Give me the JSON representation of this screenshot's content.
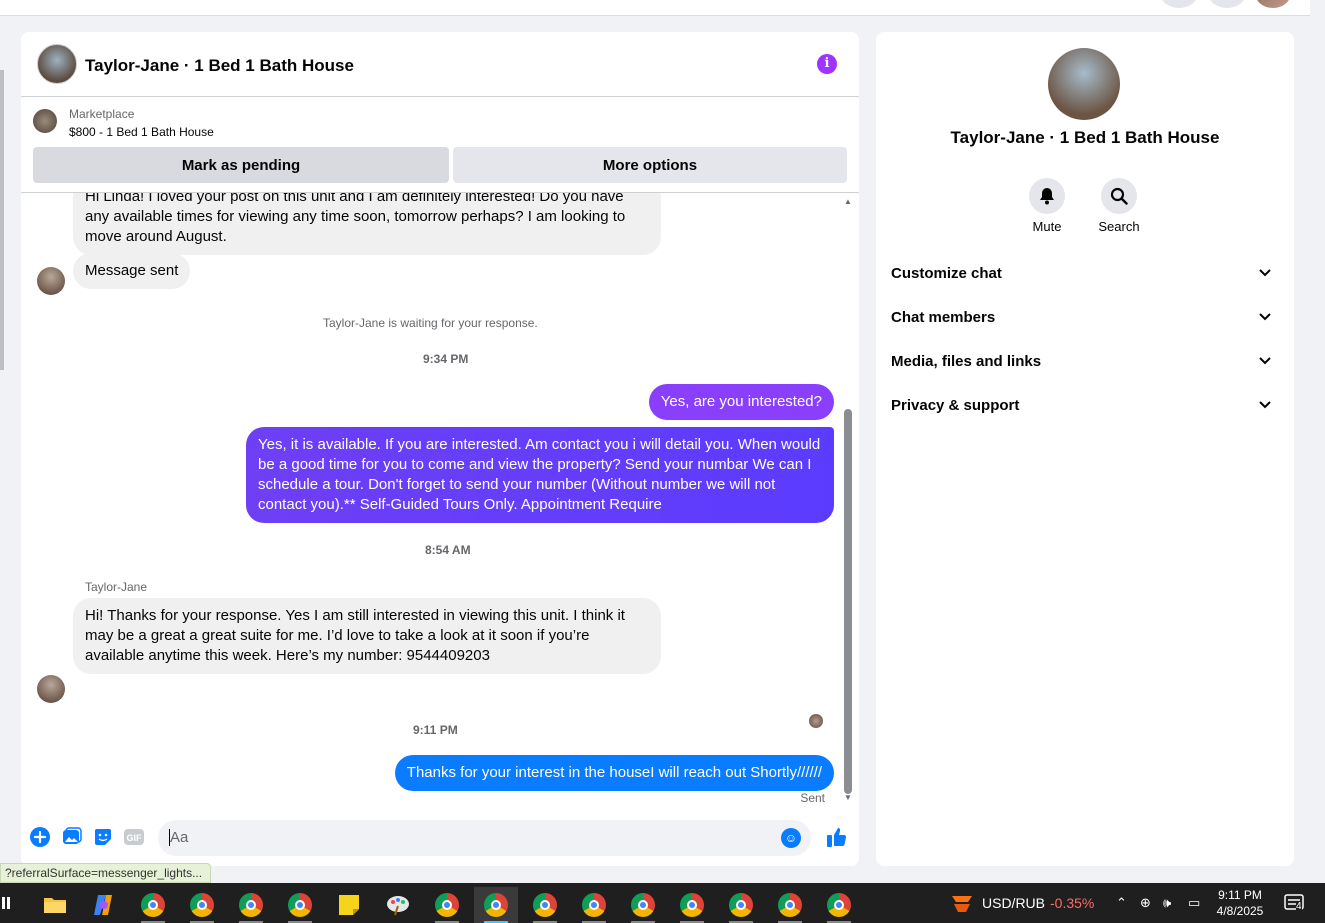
{
  "chat": {
    "title": "Taylor-Jane · 1 Bed 1 Bath House",
    "info_icon": "i",
    "marketplace": {
      "label": "Marketplace",
      "price_line": "$800 - 1 Bed 1 Bath House",
      "mark_pending_label": "Mark as pending",
      "more_options_label": "More options"
    },
    "messages": {
      "m1": "Hi Linda! I loved your post on this unit and I am definitely interested! Do you have any available times for viewing any time soon, tomorrow perhaps? I am looking to move around August.",
      "m2": "Message sent",
      "waiting": "Taylor-Jane is waiting for your response.",
      "time1": "9:34 PM",
      "m3": "Yes, are you interested?",
      "m4": "Yes, it is available. If you are interested.  Am contact you i will detail you.  When would be a good time for you to come and view the property? Send your numbar We can I schedule a tour.  Don't forget to send your number (Without number we will not contact you).** Self-Guided Tours Only. Appointment Require",
      "time2": "8:54 AM",
      "sender": "Taylor-Jane",
      "m5": "Hi! Thanks for your response. Yes I am still interested in viewing this unit. I think it may be a great a great suite for me. I’d love to take a look at it soon if you’re available anytime this week. Here’s my number: 9544409203",
      "time3": "9:11 PM",
      "m6": "Thanks for your interest in the houseI will reach out Shortly//////",
      "status": "Sent"
    },
    "composer": {
      "placeholder": "Aa",
      "icons": [
        "plus-icon",
        "photo-icon",
        "sticker-icon",
        "gif-icon",
        "emoji-icon",
        "thumbs-up-icon"
      ],
      "gif_label": "GIF"
    }
  },
  "right_panel": {
    "title": "Taylor-Jane · 1 Bed 1 Bath House",
    "mute_label": "Mute",
    "search_label": "Search",
    "sections": [
      "Customize chat",
      "Chat members",
      "Media, files and links",
      "Privacy & support"
    ]
  },
  "status_url": "?referralSurface=messenger_lights...",
  "taskbar": {
    "currency": "USD/RUB",
    "change": "-0.35%",
    "time": "9:11 PM",
    "date": "4/8/2025",
    "notifications": "4"
  },
  "colors": {
    "accent_purple": "#7b3ff2",
    "accent_blue": "#0a7cff",
    "info_purple": "#a033ff"
  }
}
